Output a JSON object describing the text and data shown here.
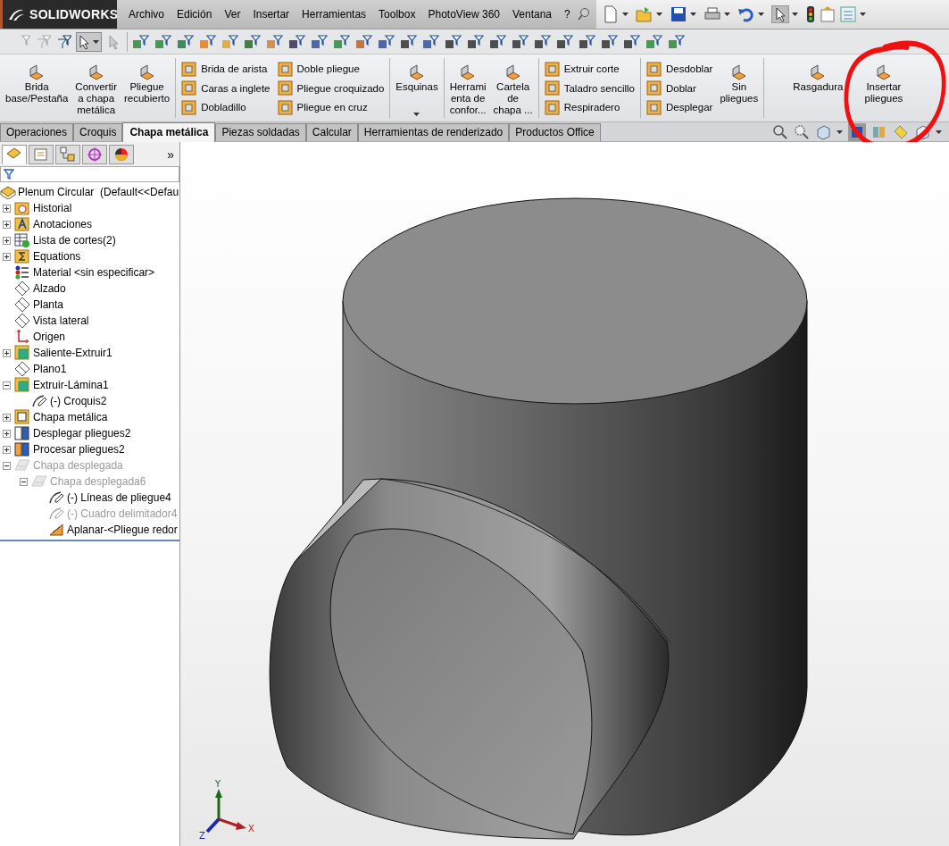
{
  "title_bar": {
    "logo": "SOLIDWORKS",
    "menu": [
      "Archivo",
      "Edición",
      "Ver",
      "Insertar",
      "Herramientas",
      "Toolbox",
      "PhotoView 360",
      "Ventana",
      "?"
    ]
  },
  "ribbon": {
    "groups": [
      {
        "items": [
          {
            "kind": "large",
            "label": "Brida\nbase/Pestaña"
          },
          {
            "kind": "large",
            "label": "Convertir\na chapa\nmetálica"
          },
          {
            "kind": "large",
            "label": "Pliegue\nrecubierto"
          }
        ]
      },
      {
        "items": [
          {
            "kind": "column",
            "buttons": [
              "Brida de arista",
              "Caras a inglete",
              "Dobladillo"
            ]
          },
          {
            "kind": "column",
            "buttons": [
              "Doble pliegue",
              "Pliegue croquizado",
              "Pliegue en cruz"
            ]
          }
        ]
      },
      {
        "items": [
          {
            "kind": "large_menu",
            "label": "Esquinas"
          }
        ]
      },
      {
        "items": [
          {
            "kind": "large",
            "label": "Herrami\nenta de\nconfor..."
          },
          {
            "kind": "large",
            "label": "Cartela\nde\nchapa ..."
          }
        ]
      },
      {
        "items": [
          {
            "kind": "column",
            "buttons": [
              "Extruir corte",
              "Taladro sencillo",
              "Respiradero"
            ]
          }
        ]
      },
      {
        "items": [
          {
            "kind": "column",
            "buttons": [
              "Desdoblar",
              "Doblar",
              "Desplegar"
            ]
          },
          {
            "kind": "large",
            "label": "Sin\npliegues"
          }
        ]
      },
      {
        "items": [
          {
            "kind": "large",
            "label": "Rasgadura"
          },
          {
            "kind": "large",
            "label": "Insertar\npliegues"
          }
        ]
      }
    ]
  },
  "tabs": [
    {
      "label": "Operaciones",
      "selected": false
    },
    {
      "label": "Croquis",
      "selected": false
    },
    {
      "label": "Chapa metálica",
      "selected": true
    },
    {
      "label": "Piezas soldadas",
      "selected": false
    },
    {
      "label": "Calcular",
      "selected": false
    },
    {
      "label": "Herramientas de renderizado",
      "selected": false
    },
    {
      "label": "Productos Office",
      "selected": false
    }
  ],
  "panel": {
    "tabs": [
      {
        "selected": true
      },
      {
        "selected": false
      },
      {
        "selected": false
      },
      {
        "selected": false
      },
      {
        "selected": false
      }
    ],
    "more": "»"
  },
  "tree": {
    "root": "Plenum Circular  (Default<<Defau",
    "items": [
      {
        "label": "Historial",
        "kind": "history",
        "expanded": false,
        "disabled": false
      },
      {
        "label": "Anotaciones",
        "kind": "annotations",
        "expanded": false,
        "disabled": false
      },
      {
        "label": "Lista de cortes(2)",
        "kind": "cutlist",
        "expanded": false,
        "disabled": false
      },
      {
        "label": "Equations",
        "kind": "equations",
        "expanded": false,
        "disabled": false
      },
      {
        "label": "Material <sin especificar>",
        "kind": "material",
        "disabled": false
      },
      {
        "label": "Alzado",
        "kind": "plane",
        "disabled": false
      },
      {
        "label": "Planta",
        "kind": "plane",
        "disabled": false
      },
      {
        "label": "Vista lateral",
        "kind": "plane",
        "disabled": false
      },
      {
        "label": "Origen",
        "kind": "origin",
        "disabled": false
      },
      {
        "label": "Saliente-Extruir1",
        "kind": "feature",
        "expanded": false,
        "disabled": false
      },
      {
        "label": "Plano1",
        "kind": "plane",
        "disabled": false
      },
      {
        "label": "Extruir-Lámina1",
        "kind": "feature",
        "expanded": true,
        "disabled": false,
        "children": [
          {
            "label": "(-) Croquis2",
            "kind": "sketch",
            "disabled": false
          }
        ]
      },
      {
        "label": "Chapa metálica",
        "kind": "sheetmetal",
        "expanded": false,
        "disabled": false
      },
      {
        "label": "Desplegar pliegues2",
        "kind": "unfold",
        "expanded": false,
        "disabled": false
      },
      {
        "label": "Procesar pliegues2",
        "kind": "process",
        "expanded": false,
        "disabled": false
      },
      {
        "label": "Chapa desplegada",
        "kind": "flat",
        "expanded": true,
        "disabled": true,
        "children": [
          {
            "label": "Chapa desplegada6",
            "kind": "flat",
            "expanded": true,
            "disabled": true,
            "children": [
              {
                "label": "(-) Líneas de pliegue4",
                "kind": "sketch",
                "disabled": false
              },
              {
                "label": "(-) Cuadro delimitador4",
                "kind": "sketch",
                "disabled": true
              },
              {
                "label": "Aplanar-<Pliegue redor",
                "kind": "flatten",
                "disabled": false
              }
            ]
          }
        ]
      }
    ]
  },
  "viewport": {
    "triad": [
      "X",
      "Y",
      "Z"
    ]
  }
}
